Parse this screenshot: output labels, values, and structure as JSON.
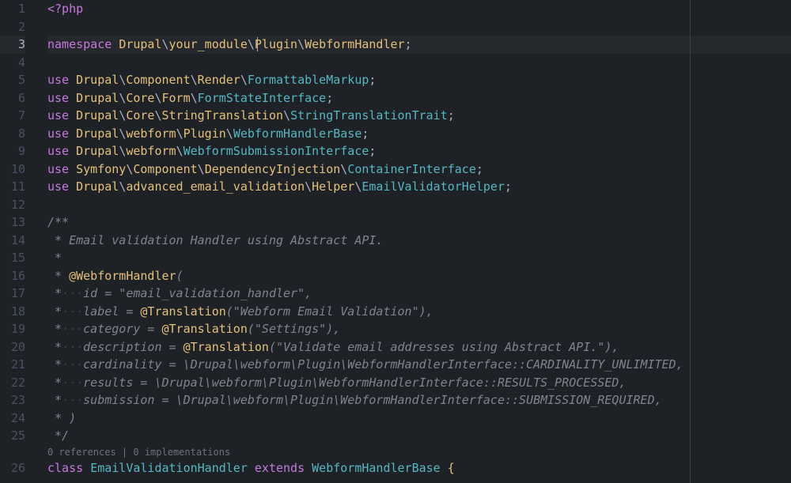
{
  "editor": {
    "language": "php",
    "activeLine": 3,
    "rulerColumn": 100,
    "codeLens": "0 references | 0 implementations",
    "codeLensBeforeLine": 26,
    "lines": [
      {
        "n": 1,
        "tokens": [
          [
            "t-php",
            "<?php"
          ]
        ]
      },
      {
        "n": 2,
        "tokens": []
      },
      {
        "n": 3,
        "tokens": [
          [
            "t-kw",
            "namespace"
          ],
          [
            "t-op",
            " "
          ],
          [
            "t-cls",
            "Drupal"
          ],
          [
            "t-op",
            "\\"
          ],
          [
            "t-cls",
            "your_module"
          ],
          [
            "t-op",
            "\\"
          ],
          [
            "t-cls",
            "Plugin"
          ],
          [
            "t-op",
            "\\"
          ],
          [
            "t-cls",
            "WebformHandler"
          ],
          [
            "t-op",
            ";"
          ]
        ]
      },
      {
        "n": 4,
        "tokens": []
      },
      {
        "n": 5,
        "tokens": [
          [
            "t-kw",
            "use"
          ],
          [
            "t-op",
            " "
          ],
          [
            "t-cls",
            "Drupal"
          ],
          [
            "t-op",
            "\\"
          ],
          [
            "t-cls",
            "Component"
          ],
          [
            "t-op",
            "\\"
          ],
          [
            "t-cls",
            "Render"
          ],
          [
            "t-op",
            "\\"
          ],
          [
            "t-type",
            "FormattableMarkup"
          ],
          [
            "t-op",
            ";"
          ]
        ]
      },
      {
        "n": 6,
        "tokens": [
          [
            "t-kw",
            "use"
          ],
          [
            "t-op",
            " "
          ],
          [
            "t-cls",
            "Drupal"
          ],
          [
            "t-op",
            "\\"
          ],
          [
            "t-cls",
            "Core"
          ],
          [
            "t-op",
            "\\"
          ],
          [
            "t-cls",
            "Form"
          ],
          [
            "t-op",
            "\\"
          ],
          [
            "t-type",
            "FormStateInterface"
          ],
          [
            "t-op",
            ";"
          ]
        ]
      },
      {
        "n": 7,
        "tokens": [
          [
            "t-kw",
            "use"
          ],
          [
            "t-op",
            " "
          ],
          [
            "t-cls",
            "Drupal"
          ],
          [
            "t-op",
            "\\"
          ],
          [
            "t-cls",
            "Core"
          ],
          [
            "t-op",
            "\\"
          ],
          [
            "t-cls",
            "StringTranslation"
          ],
          [
            "t-op",
            "\\"
          ],
          [
            "t-type",
            "StringTranslationTrait"
          ],
          [
            "t-op",
            ";"
          ]
        ]
      },
      {
        "n": 8,
        "tokens": [
          [
            "t-kw",
            "use"
          ],
          [
            "t-op",
            " "
          ],
          [
            "t-cls",
            "Drupal"
          ],
          [
            "t-op",
            "\\"
          ],
          [
            "t-cls",
            "webform"
          ],
          [
            "t-op",
            "\\"
          ],
          [
            "t-cls",
            "Plugin"
          ],
          [
            "t-op",
            "\\"
          ],
          [
            "t-type",
            "WebformHandlerBase"
          ],
          [
            "t-op",
            ";"
          ]
        ]
      },
      {
        "n": 9,
        "tokens": [
          [
            "t-kw",
            "use"
          ],
          [
            "t-op",
            " "
          ],
          [
            "t-cls",
            "Drupal"
          ],
          [
            "t-op",
            "\\"
          ],
          [
            "t-cls",
            "webform"
          ],
          [
            "t-op",
            "\\"
          ],
          [
            "t-type",
            "WebformSubmissionInterface"
          ],
          [
            "t-op",
            ";"
          ]
        ]
      },
      {
        "n": 10,
        "tokens": [
          [
            "t-kw",
            "use"
          ],
          [
            "t-op",
            " "
          ],
          [
            "t-cls",
            "Symfony"
          ],
          [
            "t-op",
            "\\"
          ],
          [
            "t-cls",
            "Component"
          ],
          [
            "t-op",
            "\\"
          ],
          [
            "t-cls",
            "DependencyInjection"
          ],
          [
            "t-op",
            "\\"
          ],
          [
            "t-type",
            "ContainerInterface"
          ],
          [
            "t-op",
            ";"
          ]
        ]
      },
      {
        "n": 11,
        "tokens": [
          [
            "t-kw",
            "use"
          ],
          [
            "t-op",
            " "
          ],
          [
            "t-cls",
            "Drupal"
          ],
          [
            "t-op",
            "\\"
          ],
          [
            "t-cls",
            "advanced_email_validation"
          ],
          [
            "t-op",
            "\\"
          ],
          [
            "t-cls",
            "Helper"
          ],
          [
            "t-op",
            "\\"
          ],
          [
            "t-type",
            "EmailValidatorHelper"
          ],
          [
            "t-op",
            ";"
          ]
        ]
      },
      {
        "n": 12,
        "tokens": []
      },
      {
        "n": 13,
        "tokens": [
          [
            "t-cmt",
            "/**"
          ]
        ]
      },
      {
        "n": 14,
        "tokens": [
          [
            "t-cmt",
            " * Email validation Handler using Abstract API."
          ]
        ]
      },
      {
        "n": 15,
        "tokens": [
          [
            "t-cmt",
            " *"
          ]
        ]
      },
      {
        "n": 16,
        "tokens": [
          [
            "t-cmt",
            " * "
          ],
          [
            "t-ann",
            "@WebformHandler"
          ],
          [
            "t-cmt",
            "("
          ]
        ]
      },
      {
        "n": 17,
        "tokens": [
          [
            "t-cmt",
            " *"
          ],
          [
            "t-ws",
            "···"
          ],
          [
            "t-cmt",
            "id = \"email_validation_handler\","
          ]
        ]
      },
      {
        "n": 18,
        "tokens": [
          [
            "t-cmt",
            " *"
          ],
          [
            "t-ws",
            "···"
          ],
          [
            "t-cmt",
            "label = "
          ],
          [
            "t-ann",
            "@Translation"
          ],
          [
            "t-cmt",
            "(\"Webform Email Validation\"),"
          ]
        ]
      },
      {
        "n": 19,
        "tokens": [
          [
            "t-cmt",
            " *"
          ],
          [
            "t-ws",
            "···"
          ],
          [
            "t-cmt",
            "category = "
          ],
          [
            "t-ann",
            "@Translation"
          ],
          [
            "t-cmt",
            "(\"Settings\"),"
          ]
        ]
      },
      {
        "n": 20,
        "tokens": [
          [
            "t-cmt",
            " *"
          ],
          [
            "t-ws",
            "···"
          ],
          [
            "t-cmt",
            "description = "
          ],
          [
            "t-ann",
            "@Translation"
          ],
          [
            "t-cmt",
            "(\"Validate email addresses using Abstract API.\"),"
          ]
        ]
      },
      {
        "n": 21,
        "tokens": [
          [
            "t-cmt",
            " *"
          ],
          [
            "t-ws",
            "···"
          ],
          [
            "t-cmt",
            "cardinality = \\Drupal\\webform\\Plugin\\WebformHandlerInterface::CARDINALITY_UNLIMITED,"
          ]
        ]
      },
      {
        "n": 22,
        "tokens": [
          [
            "t-cmt",
            " *"
          ],
          [
            "t-ws",
            "···"
          ],
          [
            "t-cmt",
            "results = \\Drupal\\webform\\Plugin\\WebformHandlerInterface::RESULTS_PROCESSED,"
          ]
        ]
      },
      {
        "n": 23,
        "tokens": [
          [
            "t-cmt",
            " *"
          ],
          [
            "t-ws",
            "···"
          ],
          [
            "t-cmt",
            "submission = \\Drupal\\webform\\Plugin\\WebformHandlerInterface::SUBMISSION_REQUIRED,"
          ]
        ]
      },
      {
        "n": 24,
        "tokens": [
          [
            "t-cmt",
            " * )"
          ]
        ]
      },
      {
        "n": 25,
        "tokens": [
          [
            "t-cmt",
            " */"
          ]
        ]
      },
      {
        "n": 26,
        "tokens": [
          [
            "t-kw",
            "class"
          ],
          [
            "t-op",
            " "
          ],
          [
            "t-type",
            "EmailValidationHandler"
          ],
          [
            "t-op",
            " "
          ],
          [
            "t-kw",
            "extends"
          ],
          [
            "t-op",
            " "
          ],
          [
            "t-type",
            "WebformHandlerBase"
          ],
          [
            "t-op",
            " "
          ],
          [
            "t-brace",
            "{"
          ]
        ]
      }
    ]
  }
}
